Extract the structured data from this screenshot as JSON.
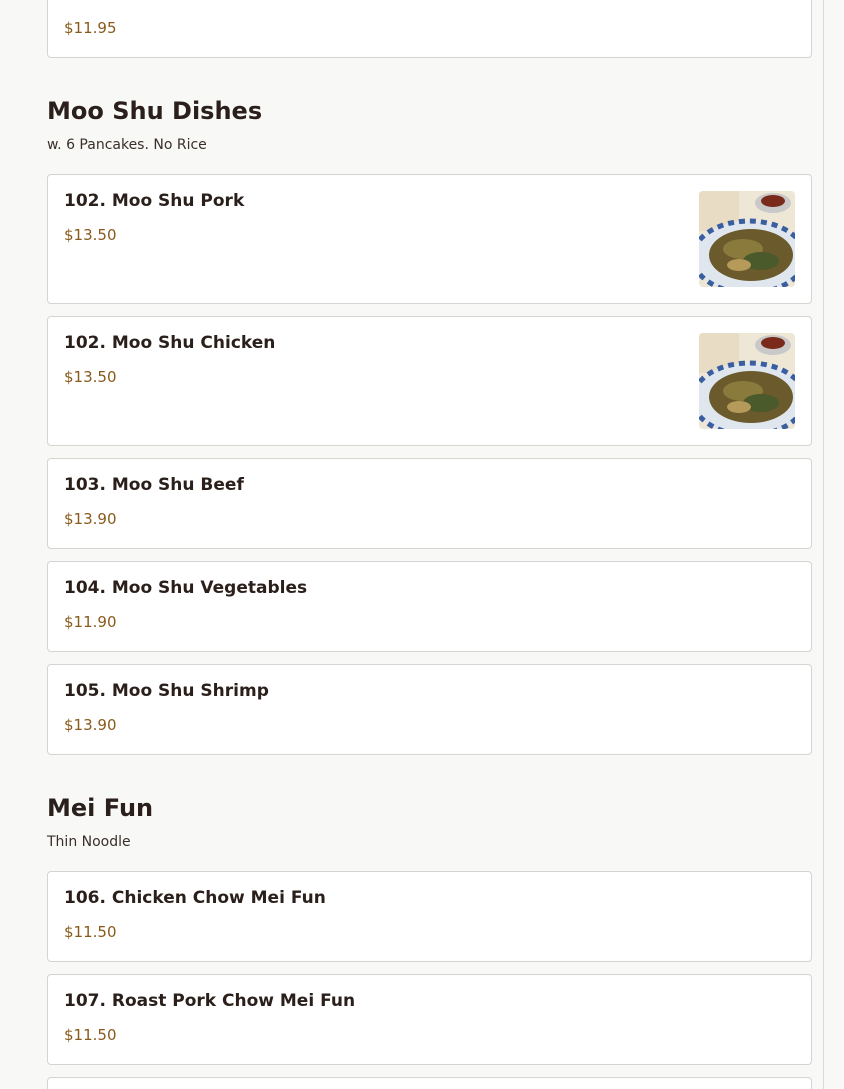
{
  "top_card": {
    "price": "$11.95"
  },
  "sections": [
    {
      "title": "Moo Shu Dishes",
      "description": "w. 6 Pancakes. No Rice",
      "items": [
        {
          "name": "102. Moo Shu Pork",
          "price": "$13.50",
          "has_image": true
        },
        {
          "name": "102. Moo Shu Chicken",
          "price": "$13.50",
          "has_image": true
        },
        {
          "name": "103. Moo Shu Beef",
          "price": "$13.90"
        },
        {
          "name": "104. Moo Shu Vegetables",
          "price": "$11.90"
        },
        {
          "name": "105. Moo Shu Shrimp",
          "price": "$13.90"
        }
      ]
    },
    {
      "title": "Mei Fun",
      "description": "Thin Noodle",
      "items": [
        {
          "name": "106. Chicken Chow Mei Fun",
          "price": "$11.50"
        },
        {
          "name": "107. Roast Pork Chow Mei Fun",
          "price": "$11.50"
        }
      ]
    }
  ]
}
